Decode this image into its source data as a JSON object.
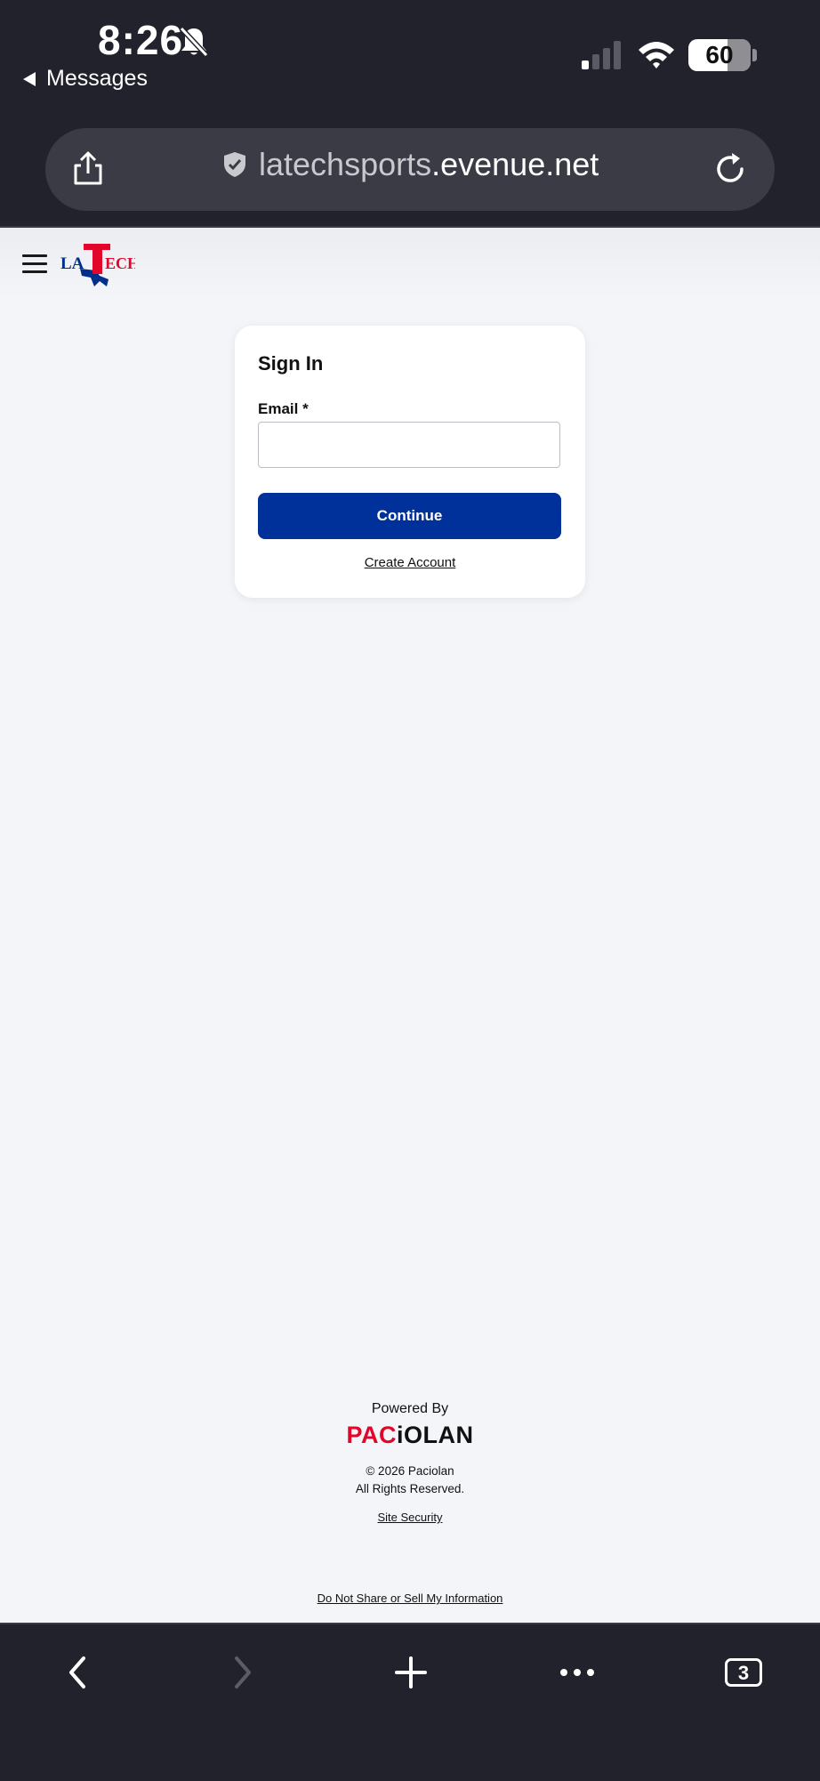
{
  "status_bar": {
    "time": "8:26",
    "back_app": "Messages",
    "battery": "60"
  },
  "browser": {
    "url_domain": "latechsports",
    "url_rest": ".evenue.net",
    "tab_count": "3"
  },
  "site": {
    "logo_text": "LA TECH"
  },
  "signin": {
    "title": "Sign In",
    "email_label": "Email *",
    "email_value": "",
    "continue_label": "Continue",
    "create_account_label": "Create Account"
  },
  "footer": {
    "powered_by": "Powered By",
    "brand_red": "PAC",
    "brand_black": "iOLAN",
    "copyright": "© 2026 Paciolan",
    "rights": "All Rights Reserved.",
    "site_security": "Site Security",
    "do_not_sell": "Do Not Share or Sell My Information"
  },
  "icons": [
    "mute-icon",
    "signal-icon",
    "wifi-icon",
    "battery-icon",
    "share-icon",
    "shield-icon",
    "reload-icon",
    "menu-icon",
    "back-icon",
    "forward-icon",
    "new-tab-icon",
    "more-icon",
    "tabs-icon"
  ],
  "colors": {
    "chrome_bg": "#22222c",
    "url_bar_bg": "#3b3b45",
    "page_bg": "#f3f5f9",
    "primary_button": "#00309a",
    "brand_red": "#e1062a"
  }
}
